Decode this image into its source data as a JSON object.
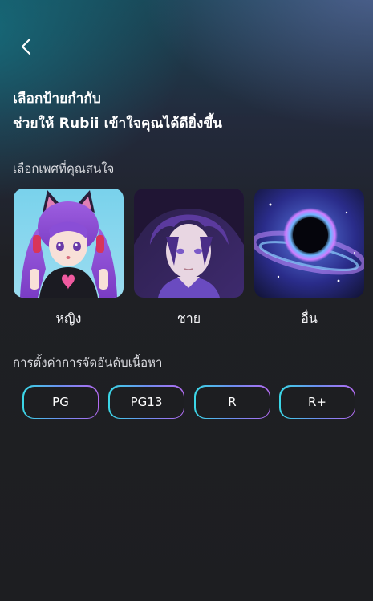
{
  "header": {
    "back_icon": "chevron-left-icon",
    "title_line1": "เลือกป้ายกำกับ",
    "title_line2": "ช่วยให้ Rubii เข้าใจคุณได้ดียิ่งขึ้น"
  },
  "gender_section": {
    "label": "เลือกเพศที่คุณสนใจ",
    "options": [
      {
        "label": "หญิง",
        "image": "anime-girl-cat-ears-portrait"
      },
      {
        "label": "ชาย",
        "image": "anime-boy-purple-hair-portrait"
      },
      {
        "label": "อื่น",
        "image": "galaxy-black-hole"
      }
    ]
  },
  "rating_section": {
    "label": "การตั้งค่าการจัดอันดับเนื้อหา",
    "options": [
      "PG",
      "PG13",
      "R",
      "R+"
    ]
  },
  "colors": {
    "background": "#1d1e21",
    "chip_gradient_start": "#3ad7e6",
    "chip_gradient_end": "#b36bf2"
  }
}
